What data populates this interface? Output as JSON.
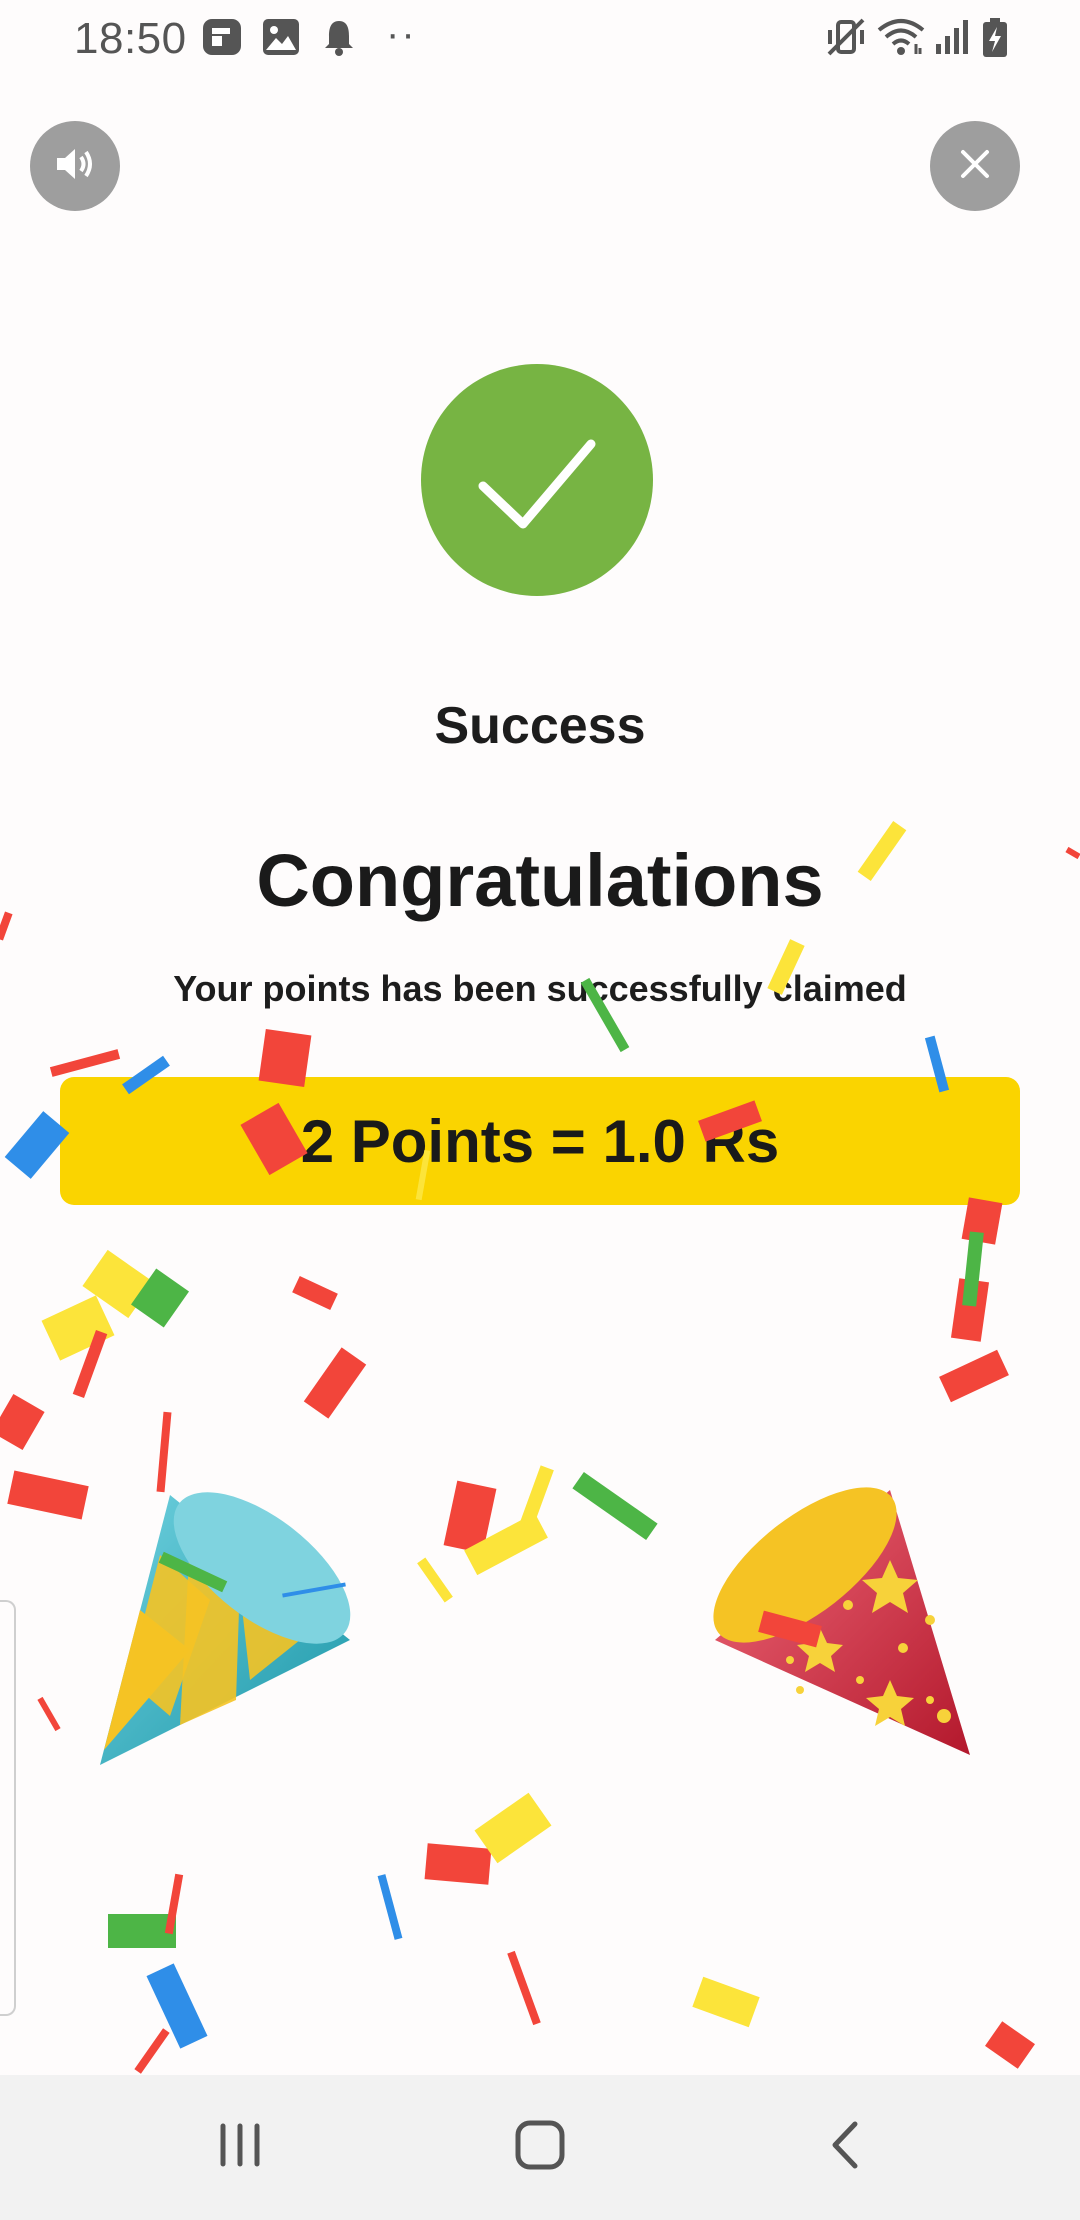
{
  "status_bar": {
    "time": "18:50",
    "more": "··",
    "left_icons": [
      "flipboard-icon",
      "gallery-icon",
      "notification-bell-icon"
    ],
    "right_icons": [
      "vibrate-mute-icon",
      "wifi-icon",
      "signal-icon",
      "battery-charging-icon"
    ]
  },
  "controls": {
    "sound_icon": "speaker-icon",
    "close_icon": "close-icon"
  },
  "dialog": {
    "success_icon": "checkmark-icon",
    "success_color": "#77b443",
    "status_label": "Success",
    "title": "Congratulations",
    "message": "Your points has been successfully claimed",
    "points_text": "2 Points = 1.0 Rs",
    "banner_color": "#fad400"
  },
  "decorations": {
    "left_icon": "party-popper-icon",
    "right_icon": "party-popper-stars-icon"
  },
  "nav_bar": {
    "recents_icon": "recent-apps-icon",
    "home_icon": "home-icon",
    "back_icon": "back-icon"
  }
}
